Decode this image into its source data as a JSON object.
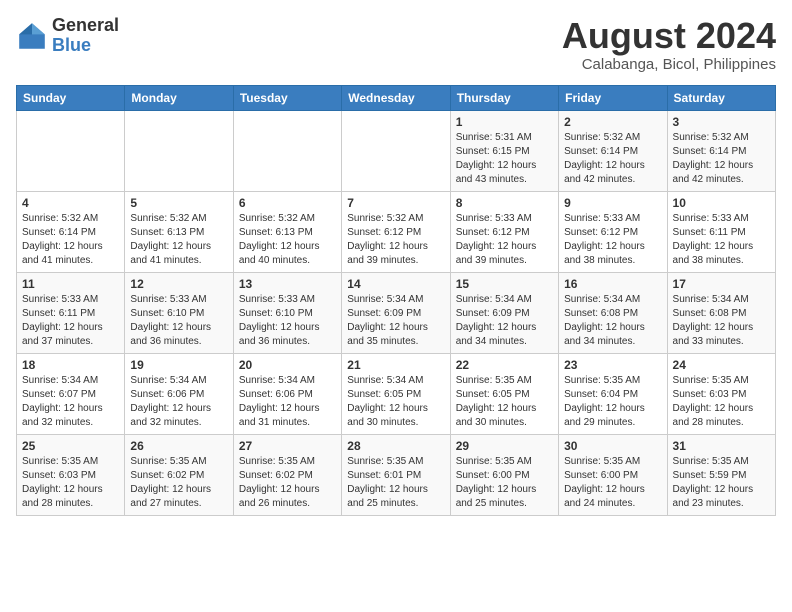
{
  "header": {
    "logo": {
      "general": "General",
      "blue": "Blue"
    },
    "month_year": "August 2024",
    "location": "Calabanga, Bicol, Philippines"
  },
  "weekdays": [
    "Sunday",
    "Monday",
    "Tuesday",
    "Wednesday",
    "Thursday",
    "Friday",
    "Saturday"
  ],
  "weeks": [
    [
      {
        "day": null,
        "sunrise": null,
        "sunset": null,
        "daylight": null
      },
      {
        "day": null,
        "sunrise": null,
        "sunset": null,
        "daylight": null
      },
      {
        "day": null,
        "sunrise": null,
        "sunset": null,
        "daylight": null
      },
      {
        "day": null,
        "sunrise": null,
        "sunset": null,
        "daylight": null
      },
      {
        "day": "1",
        "sunrise": "5:31 AM",
        "sunset": "6:15 PM",
        "daylight": "12 hours and 43 minutes."
      },
      {
        "day": "2",
        "sunrise": "5:32 AM",
        "sunset": "6:14 PM",
        "daylight": "12 hours and 42 minutes."
      },
      {
        "day": "3",
        "sunrise": "5:32 AM",
        "sunset": "6:14 PM",
        "daylight": "12 hours and 42 minutes."
      }
    ],
    [
      {
        "day": "4",
        "sunrise": "5:32 AM",
        "sunset": "6:14 PM",
        "daylight": "12 hours and 41 minutes."
      },
      {
        "day": "5",
        "sunrise": "5:32 AM",
        "sunset": "6:13 PM",
        "daylight": "12 hours and 41 minutes."
      },
      {
        "day": "6",
        "sunrise": "5:32 AM",
        "sunset": "6:13 PM",
        "daylight": "12 hours and 40 minutes."
      },
      {
        "day": "7",
        "sunrise": "5:32 AM",
        "sunset": "6:12 PM",
        "daylight": "12 hours and 39 minutes."
      },
      {
        "day": "8",
        "sunrise": "5:33 AM",
        "sunset": "6:12 PM",
        "daylight": "12 hours and 39 minutes."
      },
      {
        "day": "9",
        "sunrise": "5:33 AM",
        "sunset": "6:12 PM",
        "daylight": "12 hours and 38 minutes."
      },
      {
        "day": "10",
        "sunrise": "5:33 AM",
        "sunset": "6:11 PM",
        "daylight": "12 hours and 38 minutes."
      }
    ],
    [
      {
        "day": "11",
        "sunrise": "5:33 AM",
        "sunset": "6:11 PM",
        "daylight": "12 hours and 37 minutes."
      },
      {
        "day": "12",
        "sunrise": "5:33 AM",
        "sunset": "6:10 PM",
        "daylight": "12 hours and 36 minutes."
      },
      {
        "day": "13",
        "sunrise": "5:33 AM",
        "sunset": "6:10 PM",
        "daylight": "12 hours and 36 minutes."
      },
      {
        "day": "14",
        "sunrise": "5:34 AM",
        "sunset": "6:09 PM",
        "daylight": "12 hours and 35 minutes."
      },
      {
        "day": "15",
        "sunrise": "5:34 AM",
        "sunset": "6:09 PM",
        "daylight": "12 hours and 34 minutes."
      },
      {
        "day": "16",
        "sunrise": "5:34 AM",
        "sunset": "6:08 PM",
        "daylight": "12 hours and 34 minutes."
      },
      {
        "day": "17",
        "sunrise": "5:34 AM",
        "sunset": "6:08 PM",
        "daylight": "12 hours and 33 minutes."
      }
    ],
    [
      {
        "day": "18",
        "sunrise": "5:34 AM",
        "sunset": "6:07 PM",
        "daylight": "12 hours and 32 minutes."
      },
      {
        "day": "19",
        "sunrise": "5:34 AM",
        "sunset": "6:06 PM",
        "daylight": "12 hours and 32 minutes."
      },
      {
        "day": "20",
        "sunrise": "5:34 AM",
        "sunset": "6:06 PM",
        "daylight": "12 hours and 31 minutes."
      },
      {
        "day": "21",
        "sunrise": "5:34 AM",
        "sunset": "6:05 PM",
        "daylight": "12 hours and 30 minutes."
      },
      {
        "day": "22",
        "sunrise": "5:35 AM",
        "sunset": "6:05 PM",
        "daylight": "12 hours and 30 minutes."
      },
      {
        "day": "23",
        "sunrise": "5:35 AM",
        "sunset": "6:04 PM",
        "daylight": "12 hours and 29 minutes."
      },
      {
        "day": "24",
        "sunrise": "5:35 AM",
        "sunset": "6:03 PM",
        "daylight": "12 hours and 28 minutes."
      }
    ],
    [
      {
        "day": "25",
        "sunrise": "5:35 AM",
        "sunset": "6:03 PM",
        "daylight": "12 hours and 28 minutes."
      },
      {
        "day": "26",
        "sunrise": "5:35 AM",
        "sunset": "6:02 PM",
        "daylight": "12 hours and 27 minutes."
      },
      {
        "day": "27",
        "sunrise": "5:35 AM",
        "sunset": "6:02 PM",
        "daylight": "12 hours and 26 minutes."
      },
      {
        "day": "28",
        "sunrise": "5:35 AM",
        "sunset": "6:01 PM",
        "daylight": "12 hours and 25 minutes."
      },
      {
        "day": "29",
        "sunrise": "5:35 AM",
        "sunset": "6:00 PM",
        "daylight": "12 hours and 25 minutes."
      },
      {
        "day": "30",
        "sunrise": "5:35 AM",
        "sunset": "6:00 PM",
        "daylight": "12 hours and 24 minutes."
      },
      {
        "day": "31",
        "sunrise": "5:35 AM",
        "sunset": "5:59 PM",
        "daylight": "12 hours and 23 minutes."
      }
    ]
  ]
}
